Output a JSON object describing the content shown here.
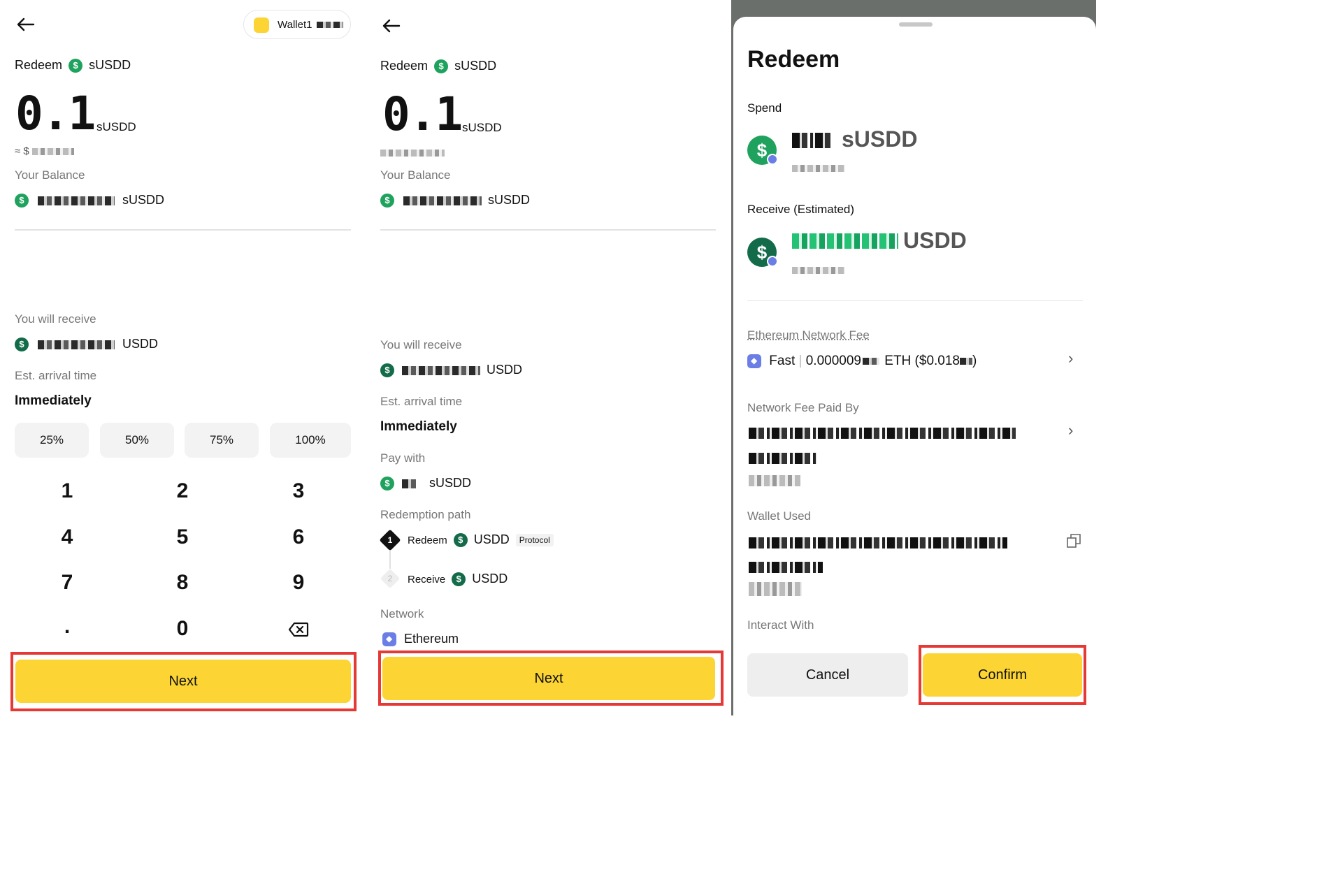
{
  "p1": {
    "wallet_label": "Wallet1",
    "redeem_label": "Redeem",
    "token": "sUSDD",
    "amount": "0.1",
    "amount_unit": "sUSDD",
    "approx_prefix": "≈ $",
    "balance_label": "Your Balance",
    "balance_unit": "sUSDD",
    "receive_label": "You will receive",
    "receive_unit": "USDD",
    "arrival_label": "Est. arrival time",
    "arrival_value": "Immediately",
    "percents": [
      "25%",
      "50%",
      "75%",
      "100%"
    ],
    "keys": [
      "1",
      "2",
      "3",
      "4",
      "5",
      "6",
      "7",
      "8",
      "9",
      ".",
      "0"
    ],
    "next_label": "Next"
  },
  "p2": {
    "redeem_label": "Redeem",
    "token": "sUSDD",
    "amount": "0.1",
    "amount_unit": "sUSDD",
    "balance_label": "Your Balance",
    "balance_unit": "sUSDD",
    "receive_label": "You will receive",
    "receive_unit": "USDD",
    "arrival_label": "Est. arrival time",
    "arrival_value": "Immediately",
    "pay_label": "Pay with",
    "pay_unit": "sUSDD",
    "path_label": "Redemption path",
    "step1_num": "1",
    "step1_action": "Redeem",
    "step1_token": "USDD",
    "step1_tag": "Protocol",
    "step2_num": "2",
    "step2_action": "Receive",
    "step2_token": "USDD",
    "network_label": "Network",
    "network_value": "Ethereum",
    "next_label": "Next"
  },
  "p3": {
    "title": "Redeem",
    "spend_label": "Spend",
    "spend_unit": "sUSDD",
    "receive_label": "Receive (Estimated)",
    "receive_unit": "USDD",
    "fee_label": "Ethereum Network Fee",
    "fee_speed": "Fast",
    "fee_separator": "|",
    "fee_amount": "0.000009",
    "fee_unit": "ETH ($0.018",
    "fee_close": ")",
    "paid_by_label": "Network Fee Paid By",
    "wallet_used_label": "Wallet Used",
    "interact_label": "Interact With",
    "cancel_label": "Cancel",
    "confirm_label": "Confirm"
  },
  "colors": {
    "accent_yellow": "#fcd535",
    "highlight_red": "#e53935",
    "coin_green": "#1fa25e",
    "eth_purple": "#6b7ee6"
  }
}
